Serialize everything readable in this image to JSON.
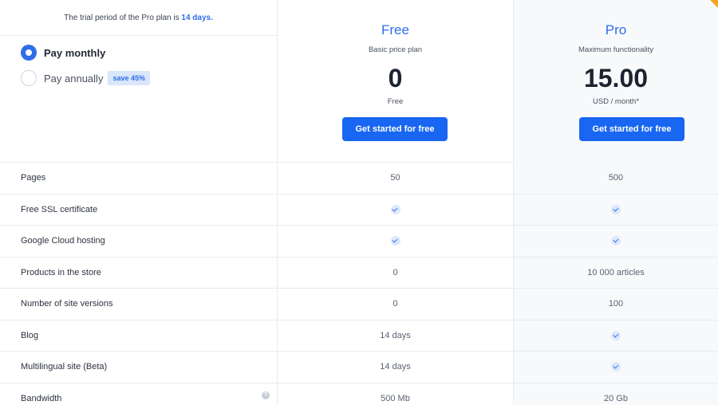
{
  "trial": {
    "text": "The trial period of the Pro plan is ",
    "highlight": "14 days."
  },
  "billing": {
    "monthly_label": "Pay monthly",
    "annually_label": "Pay annually",
    "save_badge": "save 45%",
    "selected": "monthly"
  },
  "plans": {
    "free": {
      "name": "Free",
      "subtitle": "Basic price plan",
      "price": "0",
      "unit": "Free",
      "button": "Get started for free"
    },
    "pro": {
      "name": "Pro",
      "subtitle": "Maximum functionality",
      "price": "15.00",
      "unit": "USD / month*",
      "button": "Get started for free"
    }
  },
  "colors": {
    "accent": "#2f6ee8",
    "button": "#1866f2",
    "corner": "#f5a524"
  },
  "features": [
    {
      "label": "Pages",
      "free": "50",
      "pro": "500"
    },
    {
      "label": "Free SSL certificate",
      "free": "check",
      "pro": "check"
    },
    {
      "label": "Google Cloud hosting",
      "free": "check",
      "pro": "check"
    },
    {
      "label": "Products in the store",
      "free": "0",
      "pro": "10 000 articles"
    },
    {
      "label": "Number of site versions",
      "free": "0",
      "pro": "100"
    },
    {
      "label": "Blog",
      "free": "14 days",
      "pro": "check"
    },
    {
      "label": "Multilingual site (Beta)",
      "free": "14 days",
      "pro": "check"
    },
    {
      "label": "Bandwidth",
      "free": "500 Mb",
      "pro": "20 Gb",
      "info_icon": "info-icon"
    }
  ]
}
